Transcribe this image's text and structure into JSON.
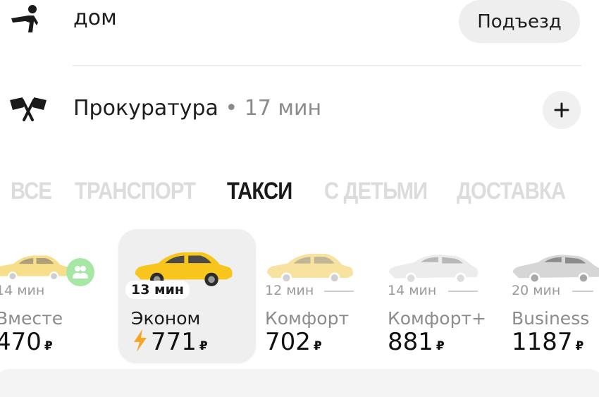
{
  "route": {
    "from": {
      "label": "дом",
      "button": "Подъезд",
      "icon": "person-pin-icon"
    },
    "to": {
      "label": "Прокуратура",
      "meta": " • 17 мин",
      "icon": "finish-flags-icon",
      "add_icon": "plus-icon"
    }
  },
  "tabs": [
    {
      "label": "ВСЕ",
      "active": false
    },
    {
      "label": "ТРАНСПОРТ",
      "active": false
    },
    {
      "label": "ТАКСИ",
      "active": true
    },
    {
      "label": "С ДЕТЬМИ",
      "active": false
    },
    {
      "label": "ДОСТАВКА",
      "active": false
    }
  ],
  "tariffs": [
    {
      "eta": "14 мин",
      "name": "Вместе",
      "price": "470",
      "currency": "₽",
      "selected": false,
      "car_color": "#f7de8a"
    },
    {
      "eta": "13 мин",
      "name": "Эконом",
      "price": "771",
      "currency": "₽",
      "selected": true,
      "car_color": "#f8c51c"
    },
    {
      "eta": "12 мин",
      "name": "Комфорт",
      "price": "702",
      "currency": "₽",
      "selected": false,
      "car_color": "#f7e2a0"
    },
    {
      "eta": "14 мин",
      "name": "Комфорт+",
      "price": "881",
      "currency": "₽",
      "selected": false,
      "car_color": "#ececec"
    },
    {
      "eta": "20 мин",
      "name": "Business",
      "price": "1187",
      "currency": "₽",
      "selected": false,
      "car_color": "#d6d6d6"
    }
  ],
  "colors": {
    "accent_yellow": "#f8c51c",
    "surge_orange": "#f5a623",
    "shared_green": "#a6e7a6"
  }
}
